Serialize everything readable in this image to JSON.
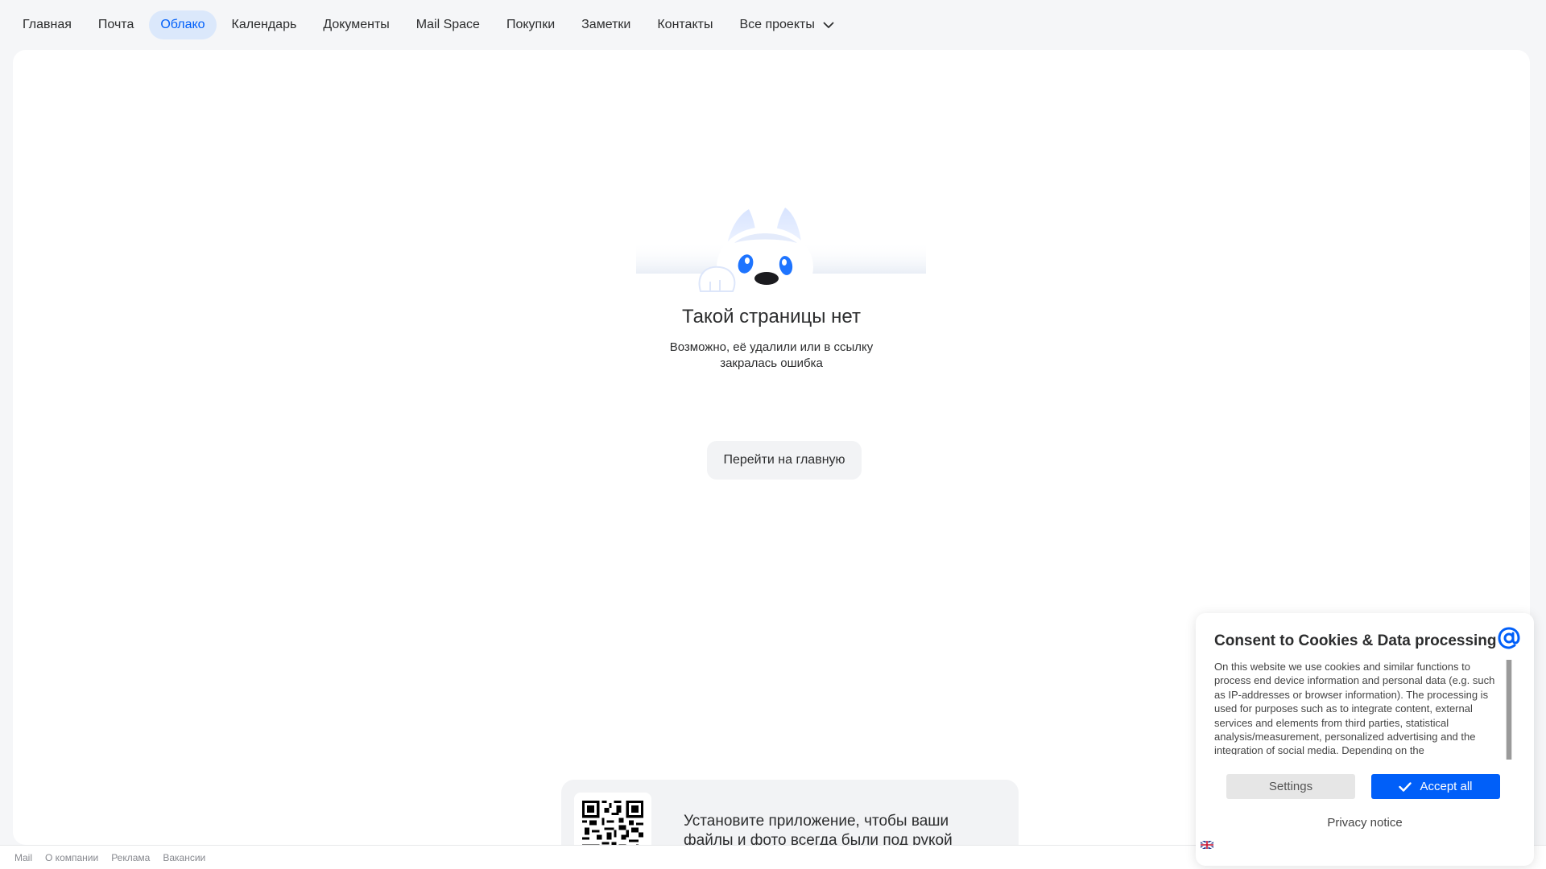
{
  "nav": {
    "items": [
      {
        "label": "Главная"
      },
      {
        "label": "Почта"
      },
      {
        "label": "Облако",
        "active": true
      },
      {
        "label": "Календарь"
      },
      {
        "label": "Документы"
      },
      {
        "label": "Mail Space"
      },
      {
        "label": "Покупки"
      },
      {
        "label": "Заметки"
      },
      {
        "label": "Контакты"
      },
      {
        "label": "Все проекты",
        "icon": "chevron-down-icon"
      }
    ]
  },
  "error": {
    "title": "Такой страницы нет",
    "description": "Возможно, её удалили или в ссылку закралась ошибка",
    "button_label": "Перейти на главную"
  },
  "promo": {
    "text": "Установите приложение, чтобы ваши файлы и фото всегда были под рукой"
  },
  "footer": {
    "links": [
      "Mail",
      "О компании",
      "Реклама",
      "Вакансии"
    ]
  },
  "cookie": {
    "title": "Consent to Cookies & Data processing",
    "body": "On this website we use cookies and similar functions to process end device information and personal data (e.g. such as IP-addresses or browser information). The processing is used for purposes such as to integrate content, external services and elements from third parties, statistical analysis/measurement, personalized advertising and the integration of social media. Depending on the",
    "settings_label": "Settings",
    "accept_label": "Accept all",
    "privacy_label": "Privacy notice"
  },
  "colors": {
    "accent": "#005ff9",
    "active_nav_bg": "#dbe8fb",
    "page_bg": "#f5f6f8"
  }
}
